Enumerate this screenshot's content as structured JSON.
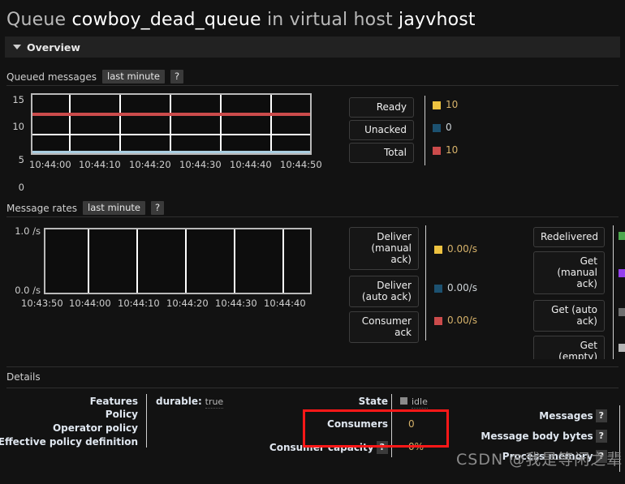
{
  "header": {
    "title_prefix": "Queue",
    "queue_name": "cowboy_dead_queue",
    "title_mid": "in virtual host",
    "vhost_name": "jayvhost"
  },
  "overview": {
    "label": "Overview",
    "toggle_icon": "triangle-down-icon"
  },
  "queued_messages": {
    "title": "Queued messages",
    "range_chip": "last minute",
    "help_chip": "?",
    "legend": [
      {
        "label": "Ready",
        "value": "10",
        "color": "#edc240"
      },
      {
        "label": "Unacked",
        "value": "0",
        "color": "#1c5170"
      },
      {
        "label": "Total",
        "value": "10",
        "color": "#cb4b4b"
      }
    ]
  },
  "message_rates": {
    "title": "Message rates",
    "range_chip": "last minute",
    "help_chip": "?",
    "legend_left": [
      {
        "label_line1": "Deliver",
        "label_line2": "(manual",
        "label_line3": "ack)",
        "value": "0.00/s",
        "color": "#edc240"
      },
      {
        "label_line1": "Deliver",
        "label_line2": "(auto ack)",
        "label_line3": "",
        "value": "0.00/s",
        "color": "#1c5170"
      },
      {
        "label_line1": "Consumer",
        "label_line2": "ack",
        "label_line3": "",
        "value": "0.00/s",
        "color": "#cb4b4b"
      }
    ],
    "legend_right": [
      {
        "label_line1": "Redelivered",
        "label_line2": "",
        "label_line3": "",
        "color": "#4da74d"
      },
      {
        "label_line1": "Get",
        "label_line2": "(manual",
        "label_line3": "ack)",
        "color": "#9440ed"
      },
      {
        "label_line1": "Get (auto",
        "label_line2": "ack)",
        "label_line3": "",
        "color": "#6f6f6f"
      },
      {
        "label_line1": "Get",
        "label_line2": "(empty)",
        "label_line3": "",
        "color": "#b6b6b6"
      }
    ]
  },
  "chart_data": [
    {
      "type": "line",
      "title": "Queued messages",
      "xlabel": "",
      "ylabel": "",
      "ylim": [
        0,
        15
      ],
      "yticks": [
        "0",
        "5",
        "10",
        "15"
      ],
      "xticks": [
        "10:44:00",
        "10:44:10",
        "10:44:20",
        "10:44:30",
        "10:44:40",
        "10:44:50"
      ],
      "grid": true,
      "legend_position": "right",
      "series": [
        {
          "name": "Ready",
          "color": "#edc240",
          "values": [
            10,
            10,
            10,
            10,
            10,
            10
          ]
        },
        {
          "name": "Unacked",
          "color": "#1c5170",
          "values": [
            0,
            0,
            0,
            0,
            0,
            0
          ]
        },
        {
          "name": "Total",
          "color": "#cb4b4b",
          "values": [
            10,
            10,
            10,
            10,
            10,
            10
          ]
        }
      ]
    },
    {
      "type": "line",
      "title": "Message rates",
      "xlabel": "",
      "ylabel": "/s",
      "ylim": [
        0,
        1
      ],
      "yticks": [
        "0.0 /s",
        "1.0 /s"
      ],
      "xticks": [
        "10:43:50",
        "10:44:00",
        "10:44:10",
        "10:44:20",
        "10:44:30",
        "10:44:40"
      ],
      "grid": true,
      "legend_position": "right",
      "series": [
        {
          "name": "Deliver (manual ack)",
          "color": "#edc240",
          "values": [
            0,
            0,
            0,
            0,
            0,
            0
          ]
        },
        {
          "name": "Deliver (auto ack)",
          "color": "#1c5170",
          "values": [
            0,
            0,
            0,
            0,
            0,
            0
          ]
        },
        {
          "name": "Consumer ack",
          "color": "#cb4b4b",
          "values": [
            0,
            0,
            0,
            0,
            0,
            0
          ]
        }
      ]
    }
  ],
  "details": {
    "title": "Details",
    "left_rows": [
      {
        "label": "Features",
        "value_key": "durable:",
        "value_text": "true"
      },
      {
        "label": "Policy",
        "value_key": "",
        "value_text": ""
      },
      {
        "label": "Operator policy",
        "value_key": "",
        "value_text": ""
      },
      {
        "label": "Effective policy definition",
        "value_key": "",
        "value_text": ""
      }
    ],
    "mid_rows": [
      {
        "label": "State",
        "help": "",
        "value": "idle",
        "has_dot": true
      },
      {
        "label": "Consumers",
        "help": "",
        "value": "0",
        "has_dot": false
      },
      {
        "label": "Consumer capacity",
        "help": "?",
        "value": "0%",
        "has_dot": false
      }
    ],
    "right_rows": [
      {
        "label": "Messages",
        "help": "?"
      },
      {
        "label": "Message body bytes",
        "help": "?"
      },
      {
        "label": "Process memory",
        "help": "?"
      }
    ]
  },
  "annotation": {
    "highlight_target": "Consumers",
    "highlight_color": "#ff1818"
  },
  "watermark": {
    "text": "CSDN @我是等闲之辈"
  }
}
